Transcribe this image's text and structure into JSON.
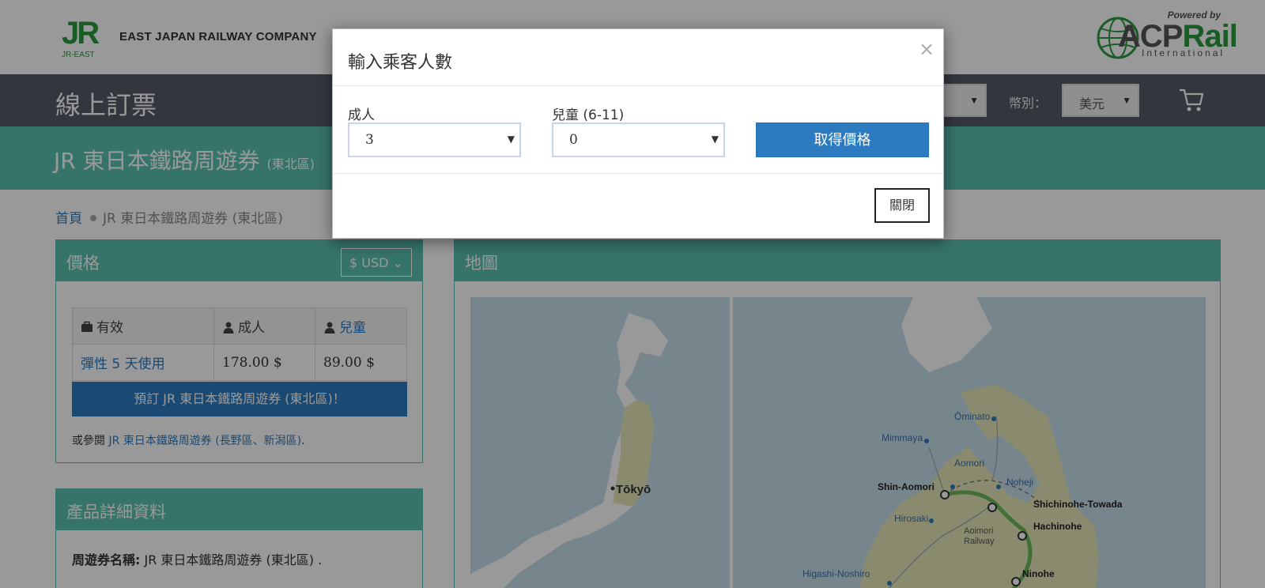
{
  "header": {
    "jr_logo": "JR",
    "jr_logo_sub": "JR-EAST",
    "company_name": "EAST JAPAN RAILWAY COMPANY",
    "acp_powered": "Powered by",
    "acp_name_a": "ACP",
    "acp_name_r": "Rail",
    "acp_intl": "International"
  },
  "navbar": {
    "title": "線上訂票",
    "language_value": "",
    "currency_label": "幣別：",
    "currency_value": "美元",
    "cart_icon": "shopping-cart-icon"
  },
  "page": {
    "title": "JR 東日本鐵路周遊券",
    "title_small": "(東北區)",
    "breadcrumb": {
      "home": "首頁",
      "current": "JR 東日本鐵路周遊券 (東北區)"
    }
  },
  "price_panel": {
    "heading": "價格",
    "currency_button": "$ USD",
    "table": {
      "headers": [
        "有效",
        "成人",
        "兒童"
      ],
      "header_icons": [
        "briefcase-icon",
        "user-icon",
        "user-icon"
      ],
      "rows": [
        {
          "validity": "彈性 5 天使用",
          "adult": "178.00 $",
          "child": "89.00 $"
        }
      ]
    },
    "book_button": "預訂 JR 東日本鐵路周遊券 (東北區)！",
    "see_also_prefix": "或參閱 ",
    "see_also_link": "JR 東日本鐵路周遊券 (長野區、新潟區)",
    "see_also_suffix": "."
  },
  "detail_panel": {
    "heading": "產品詳細資料",
    "label": "周遊券名稱:",
    "value": " JR 東日本鐵路周遊券 (東北區) ."
  },
  "map_panel": {
    "heading": "地圖",
    "tokyo_label": "Tōkyō",
    "stations": [
      "Ōminato",
      "Mimmaya",
      "Aomori",
      "Shin-Aomori",
      "Noheji",
      "Shichinohe-Towada",
      "Hirosaki",
      "Hachinohe",
      "Aoimori",
      "Railway",
      "Higashi-Noshiro",
      "Ninohe"
    ]
  },
  "modal": {
    "title": "輸入乘客人數",
    "close_symbol": "×",
    "adult_label": "成人",
    "adult_value": "3",
    "child_label": "兒童 (6-11)",
    "child_value": "0",
    "get_price_button": "取得價格",
    "close_button": "關閉"
  },
  "colors": {
    "teal": "#5bc0b0",
    "navbar": "#555d66",
    "primary_blue": "#2c7bc0",
    "jr_green": "#2a9a3e"
  }
}
